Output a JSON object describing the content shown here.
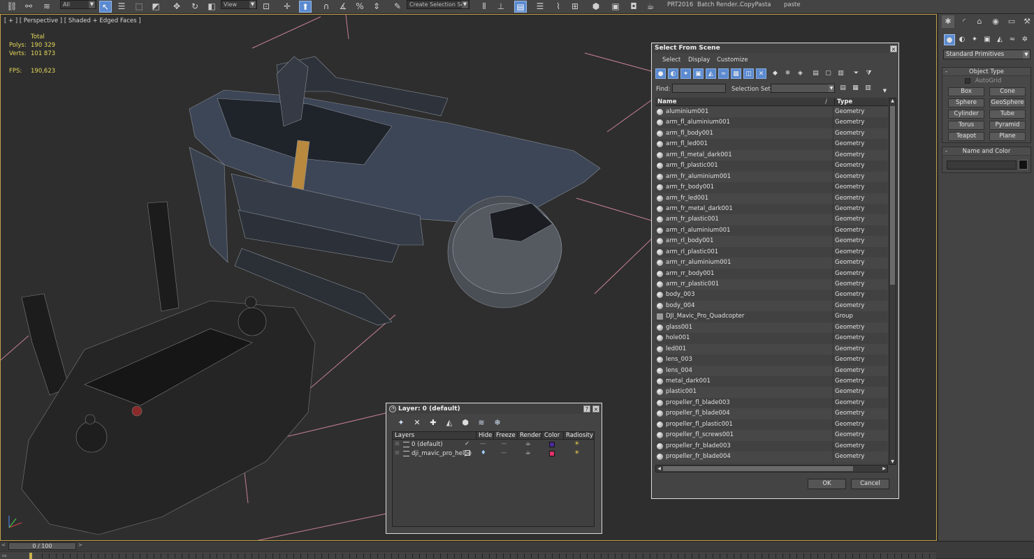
{
  "toolbar": {
    "selection_filter": "All",
    "view_combo": "View",
    "selection_set_placeholder": "Create Selection Se",
    "shelf_items": [
      "PRT2016",
      "Batch Render...",
      "CopyPasta",
      "paste"
    ]
  },
  "viewport": {
    "label": "[ + ] [ Perspective ] [ Shaded + Edged Faces ]",
    "stats": {
      "total_label": "Total",
      "polys_label": "Polys:",
      "polys_value": "190 329",
      "verts_label": "Verts:",
      "verts_value": "101 873",
      "fps_label": "FPS:",
      "fps_value": "190,623"
    }
  },
  "command_panel": {
    "category": "Standard Primitives",
    "object_type_title": "Object Type",
    "autogrid_label": "AutoGrid",
    "primitives": [
      "Box",
      "Cone",
      "Sphere",
      "GeoSphere",
      "Cylinder",
      "Tube",
      "Torus",
      "Pyramid",
      "Teapot",
      "Plane"
    ],
    "name_color_title": "Name and Color",
    "name_value": "",
    "object_color": "#111111"
  },
  "timeline": {
    "frame_display": "0 / 100"
  },
  "select_from_scene": {
    "title": "Select From Scene",
    "menu": [
      "Select",
      "Display",
      "Customize"
    ],
    "find_label": "Find:",
    "find_value": "",
    "selection_set_label": "Selection Set:",
    "selection_set_value": "",
    "columns": {
      "name": "Name",
      "sort_indicator": "/",
      "type": "Type"
    },
    "rows": [
      {
        "name": "aluminium001",
        "type": "Geometry"
      },
      {
        "name": "arm_fl_aluminium001",
        "type": "Geometry"
      },
      {
        "name": "arm_fl_body001",
        "type": "Geometry"
      },
      {
        "name": "arm_fl_led001",
        "type": "Geometry"
      },
      {
        "name": "arm_fl_metal_dark001",
        "type": "Geometry"
      },
      {
        "name": "arm_fl_plastic001",
        "type": "Geometry"
      },
      {
        "name": "arm_fr_aluminium001",
        "type": "Geometry"
      },
      {
        "name": "arm_fr_body001",
        "type": "Geometry"
      },
      {
        "name": "arm_fr_led001",
        "type": "Geometry"
      },
      {
        "name": "arm_fr_metal_dark001",
        "type": "Geometry"
      },
      {
        "name": "arm_fr_plastic001",
        "type": "Geometry"
      },
      {
        "name": "arm_rl_aluminium001",
        "type": "Geometry"
      },
      {
        "name": "arm_rl_body001",
        "type": "Geometry"
      },
      {
        "name": "arm_rl_plastic001",
        "type": "Geometry"
      },
      {
        "name": "arm_rr_aluminium001",
        "type": "Geometry"
      },
      {
        "name": "arm_rr_body001",
        "type": "Geometry"
      },
      {
        "name": "arm_rr_plastic001",
        "type": "Geometry"
      },
      {
        "name": "body_003",
        "type": "Geometry"
      },
      {
        "name": "body_004",
        "type": "Geometry"
      },
      {
        "name": "DJI_Mavic_Pro_Quadcopter",
        "type": "Group"
      },
      {
        "name": "glass001",
        "type": "Geometry"
      },
      {
        "name": "hole001",
        "type": "Geometry"
      },
      {
        "name": "led001",
        "type": "Geometry"
      },
      {
        "name": "lens_003",
        "type": "Geometry"
      },
      {
        "name": "lens_004",
        "type": "Geometry"
      },
      {
        "name": "metal_dark001",
        "type": "Geometry"
      },
      {
        "name": "plastic001",
        "type": "Geometry"
      },
      {
        "name": "propeller_fl_blade003",
        "type": "Geometry"
      },
      {
        "name": "propeller_fl_blade004",
        "type": "Geometry"
      },
      {
        "name": "propeller_fl_plastic001",
        "type": "Geometry"
      },
      {
        "name": "propeller_fl_screws001",
        "type": "Geometry"
      },
      {
        "name": "propeller_fr_blade003",
        "type": "Geometry"
      },
      {
        "name": "propeller_fr_blade004",
        "type": "Geometry"
      }
    ],
    "ok_label": "OK",
    "cancel_label": "Cancel"
  },
  "layer_dialog": {
    "title": "Layer: 0 (default)",
    "columns": [
      "Layers",
      "Hide",
      "Freeze",
      "Render",
      "Color",
      "Radiosity"
    ],
    "layers": [
      {
        "name": "0 (default)",
        "color": "#4a2a9a",
        "current": true
      },
      {
        "name": "dji_mavic_pro_helpe",
        "color": "#e0356a",
        "current": false
      }
    ]
  }
}
